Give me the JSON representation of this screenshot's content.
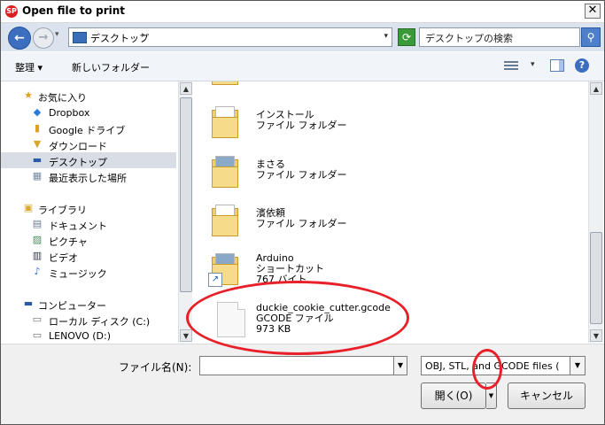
{
  "window": {
    "title": "Open file to print",
    "app_icon_text": "SP",
    "close_glyph": "✕"
  },
  "address": {
    "location": "デスクトップ",
    "search_placeholder": "デスクトップの検索"
  },
  "toolbar": {
    "organize_label": "整理 ▾",
    "new_folder_label": "新しいフォルダー"
  },
  "nav": {
    "favorites": {
      "label": "お気に入り",
      "items": [
        {
          "label": "Dropbox"
        },
        {
          "label": "Google ドライブ"
        },
        {
          "label": "ダウンロード"
        },
        {
          "label": "デスクトップ"
        },
        {
          "label": "最近表示した場所"
        }
      ]
    },
    "libraries": {
      "label": "ライブラリ",
      "items": [
        {
          "label": "ドキュメント"
        },
        {
          "label": "ピクチャ"
        },
        {
          "label": "ビデオ"
        },
        {
          "label": "ミュージック"
        }
      ]
    },
    "computer": {
      "label": "コンピューター",
      "items": [
        {
          "label": "ローカル ディスク (C:)"
        },
        {
          "label": "LENOVO (D:)"
        }
      ]
    }
  },
  "files": [
    {
      "name": "インストール",
      "type": "ファイル フォルダー",
      "extra": ""
    },
    {
      "name": "まさる",
      "type": "ファイル フォルダー",
      "extra": ""
    },
    {
      "name": "濱依頼",
      "type": "ファイル フォルダー",
      "extra": ""
    },
    {
      "name": "Arduino",
      "type": "ショートカット",
      "extra": "767 バイト"
    },
    {
      "name": "duckie_cookie_cutter.gcode",
      "type": "GCODE ファイル",
      "extra": "973 KB"
    }
  ],
  "bottom": {
    "filename_label": "ファイル名(N):",
    "filename_value": "",
    "filetype_value": "OBJ, STL, and GCODE files (",
    "open_label": "開く(O)",
    "cancel_label": "キャンセル"
  },
  "colors": {
    "annotation": "#e8202a",
    "selected_nav": "#d8dde6"
  }
}
